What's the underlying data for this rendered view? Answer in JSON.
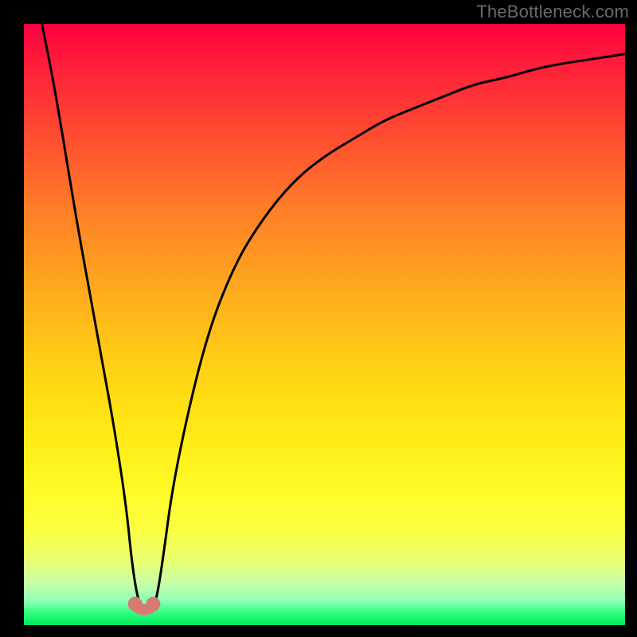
{
  "watermark": "TheBottleneck.com",
  "chart_data": {
    "type": "line",
    "title": "",
    "xlabel": "",
    "ylabel": "",
    "xlim": [
      0,
      100
    ],
    "ylim": [
      0,
      100
    ],
    "grid": false,
    "legend": false,
    "gradient_stops": [
      {
        "pos": 0,
        "color": "#ff0040"
      },
      {
        "pos": 50,
        "color": "#ffc010"
      },
      {
        "pos": 80,
        "color": "#ffff30"
      },
      {
        "pos": 100,
        "color": "#00e85e"
      }
    ],
    "series": [
      {
        "name": "bottleneck-curve",
        "color": "#000000",
        "x": [
          3,
          5,
          7,
          9,
          11,
          13,
          15,
          17,
          18,
          19,
          20,
          21,
          22,
          23,
          25,
          30,
          35,
          40,
          45,
          50,
          55,
          60,
          65,
          70,
          75,
          80,
          85,
          90,
          95,
          100
        ],
        "y_percent": [
          100,
          90,
          78,
          66,
          55,
          44,
          33,
          20,
          10,
          4,
          2,
          2,
          4,
          10,
          25,
          47,
          60,
          68,
          74,
          78,
          81,
          84,
          86,
          88,
          90,
          91,
          92.5,
          93.5,
          94.2,
          95
        ]
      }
    ],
    "markers": [
      {
        "name": "valley-left",
        "x": 18.5,
        "y_percent": 3.5,
        "color": "#d77a72",
        "r": 9
      },
      {
        "name": "valley-right",
        "x": 21.5,
        "y_percent": 3.5,
        "color": "#d77a72",
        "r": 9
      }
    ]
  }
}
